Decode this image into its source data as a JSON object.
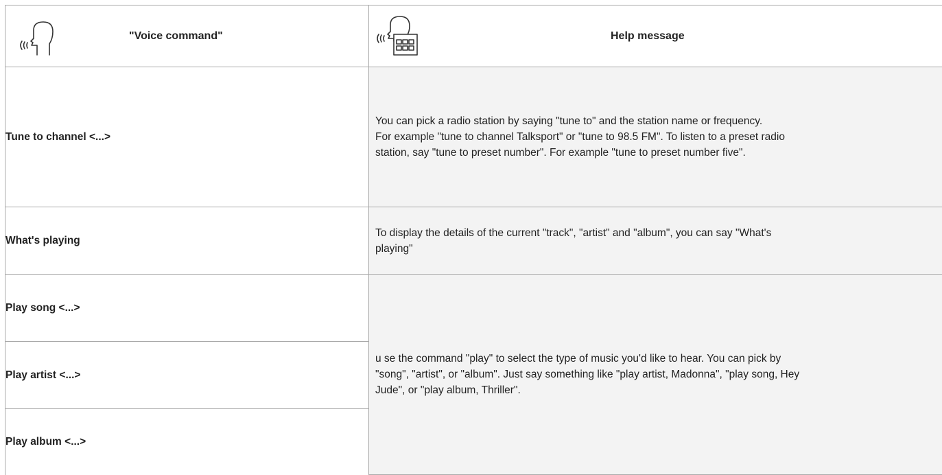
{
  "header": {
    "command_title": "\"Voice command\"",
    "help_title": "Help message",
    "command_icon": "speaking-head-icon",
    "help_icon": "speaking-head-screen-icon"
  },
  "rows": [
    {
      "command": "Tune to channel <...>",
      "help_lines": [
        "You can pick a radio station by saying \"tune to\" and the station name or frequency.",
        "For example \"tune to channel Talksport\" or \"tune to 98.5 FM\". To listen to a preset radio",
        "station, say \"tune to preset number\". For example \"tune to preset number five\"."
      ]
    },
    {
      "command": "What's playing",
      "help_lines": [
        "To display the details of the current \"track\", \"artist\" and \"album\", you can say \"What's",
        "playing\""
      ]
    },
    {
      "command": "Play song <...>",
      "help_lines": [
        "u se the command \"play\" to select the type of music you'd like to hear. You can pick by",
        "\"song\", \"artist\", or \"album\". Just say something like \"play artist, Madonna\", \"play song, Hey",
        "Jude\", or \"play album, Thriller\"."
      ]
    },
    {
      "command": "Play artist <...>"
    },
    {
      "command": "Play album <...>"
    }
  ],
  "colors": {
    "border": "#a9a9a9",
    "help_background": "#f3f3f3",
    "text": "#222222"
  }
}
